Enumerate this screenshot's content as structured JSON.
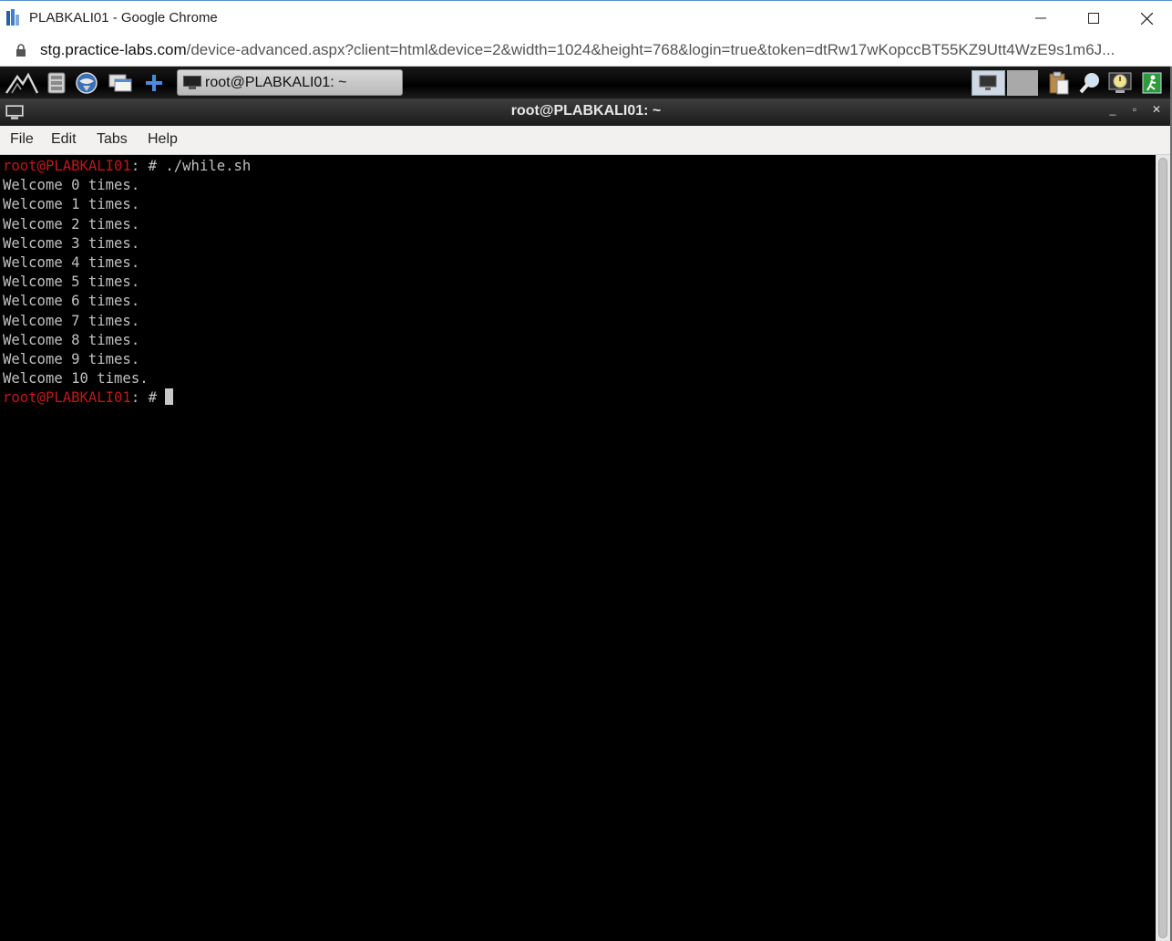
{
  "browser": {
    "title": "PLABKALI01 - Google Chrome",
    "url_host": "stg.practice-labs.com",
    "url_rest": "/device-advanced.aspx?client=html&device=2&width=1024&height=768&login=true&token=dtRw17wKopccBT55KZ9Utt4WzE9s1m6J..."
  },
  "panel": {
    "taskbar_item": "root@PLABKALI01: ~",
    "icons": [
      "kali-menu-icon",
      "file-manager-icon",
      "browser-icon",
      "show-desktop-icon",
      "add-icon"
    ],
    "tray_icons": [
      "monitor-icon",
      "clipboard-icon",
      "magnifier-icon",
      "clock-icon",
      "exit-icon"
    ]
  },
  "terminal_window": {
    "title": "root@PLABKALI01: ~",
    "buttons": [
      "_",
      "▫",
      "✕"
    ]
  },
  "menu": {
    "file": "File",
    "edit": "Edit",
    "tabs": "Tabs",
    "help": "Help"
  },
  "terminal": {
    "prompt_user": "root@PLABKALI01",
    "prompt_suffix": ": # ",
    "command": "./while.sh",
    "output": [
      "Welcome 0 times.",
      "Welcome 1 times.",
      "Welcome 2 times.",
      "Welcome 3 times.",
      "Welcome 4 times.",
      "Welcome 5 times.",
      "Welcome 6 times.",
      "Welcome 7 times.",
      "Welcome 8 times.",
      "Welcome 9 times.",
      "Welcome 10 times."
    ]
  }
}
